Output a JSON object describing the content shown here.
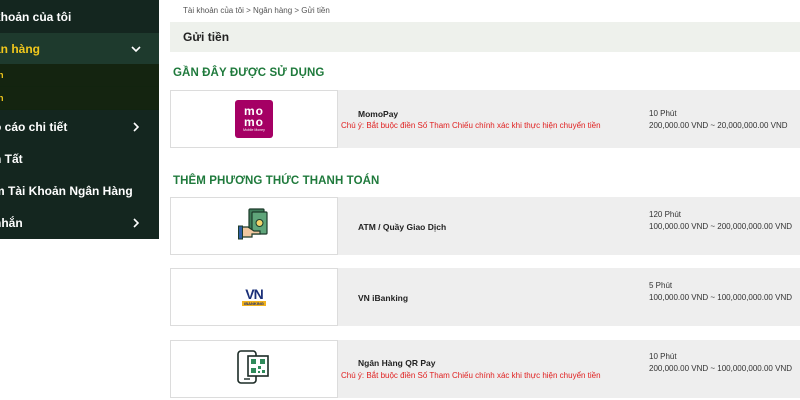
{
  "sidebar": {
    "items": [
      {
        "label": "khoản của tôi"
      },
      {
        "label": "ân hàng"
      },
      {
        "label": "o cáo chi tiết"
      },
      {
        "label": "n Tất"
      },
      {
        "label": "m Tài Khoản Ngân Hàng"
      },
      {
        "label": "nhắn"
      }
    ],
    "subitems": [
      {
        "label": "n"
      },
      {
        "label": "n"
      }
    ]
  },
  "breadcrumb": "Tài khoản của tôi > Ngân hàng > Gửi tiền",
  "page_title": "Gửi tiền",
  "sections": {
    "recent": "GẦN ĐÂY ĐƯỢC SỬ DỤNG",
    "add": "THÊM PHƯƠNG THỨC THANH TOÁN"
  },
  "methods": [
    {
      "name": "MomoPay",
      "note": "Chú ý: Bắt buộc điền Số Tham Chiếu chính xác khi thực hiện chuyển tiền",
      "time": "10 Phút",
      "range": "200,000.00 VND ~ 20,000,000.00 VND",
      "logo": {
        "line1": "mo",
        "line2": "mo",
        "tag": "Mobile Money",
        "color": "#a50064"
      }
    },
    {
      "name": "ATM / Quầy Giao Dịch",
      "note": "",
      "time": "120 Phút",
      "range": "100,000.00 VND ~ 200,000,000.00 VND",
      "logo": {
        "icon": "cash-hand-icon"
      }
    },
    {
      "name": "VN iBanking",
      "note": "",
      "time": "5 Phút",
      "range": "100,000.00 VND ~ 100,000,000.00 VND",
      "logo": {
        "text": "VN",
        "sub": "iBANKING"
      }
    },
    {
      "name": "Ngân Hàng QR Pay",
      "note": "Chú ý: Bắt buộc điền Số Tham Chiếu chính xác khi thực hiện chuyển tiền",
      "time": "10 Phút",
      "range": "200,000.00 VND ~ 100,000,000.00 VND",
      "logo": {
        "icon": "qr-phone-icon"
      }
    }
  ],
  "colors": {
    "sidebar_bg": "#14261f",
    "active_text": "#f2c81c",
    "section_green": "#1f7a3c",
    "note_red": "#e02020",
    "momo": "#a50064"
  }
}
